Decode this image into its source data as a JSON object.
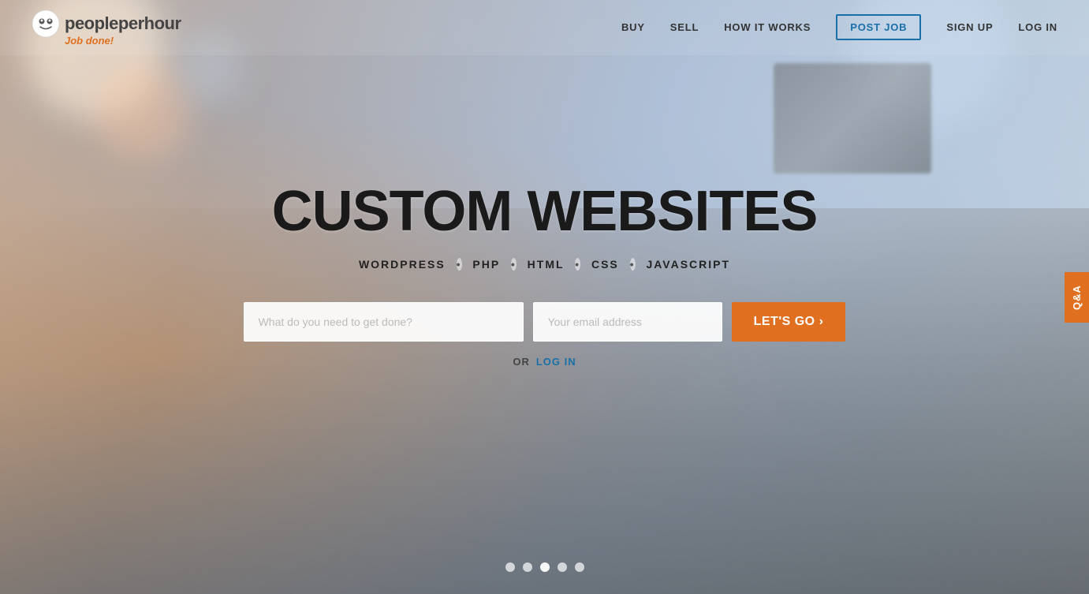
{
  "brand": {
    "logo_text": "peopleperhour",
    "tagline": "Job done!",
    "logo_people": "people",
    "logo_per": "per",
    "logo_hour": "hour"
  },
  "nav": {
    "buy_label": "BUY",
    "sell_label": "SELL",
    "how_it_works_label": "HOW IT WORKS",
    "post_job_label": "POST JOB",
    "sign_up_label": "SIGN UP",
    "log_in_label": "LOG IN"
  },
  "hero": {
    "title": "CUSTOM WEBSITES",
    "subtitle_items": [
      "WORDPRESS",
      "PHP",
      "HTML",
      "CSS",
      "JAVASCRIPT"
    ],
    "task_placeholder": "What do you need to get done?",
    "email_placeholder": "Your email address",
    "cta_label": "LET'S GO ›",
    "or_label": "OR",
    "login_label": "LOG IN"
  },
  "qa_tab": {
    "label": "Q&A"
  },
  "carousel": {
    "dots": [
      {
        "active": false,
        "id": 1
      },
      {
        "active": true,
        "id": 2
      },
      {
        "active": false,
        "id": 3
      },
      {
        "active": false,
        "id": 4
      },
      {
        "active": false,
        "id": 5
      }
    ]
  },
  "colors": {
    "orange": "#e07020",
    "blue": "#1a6fa8",
    "dark": "#1a1a1a",
    "white": "#ffffff"
  }
}
